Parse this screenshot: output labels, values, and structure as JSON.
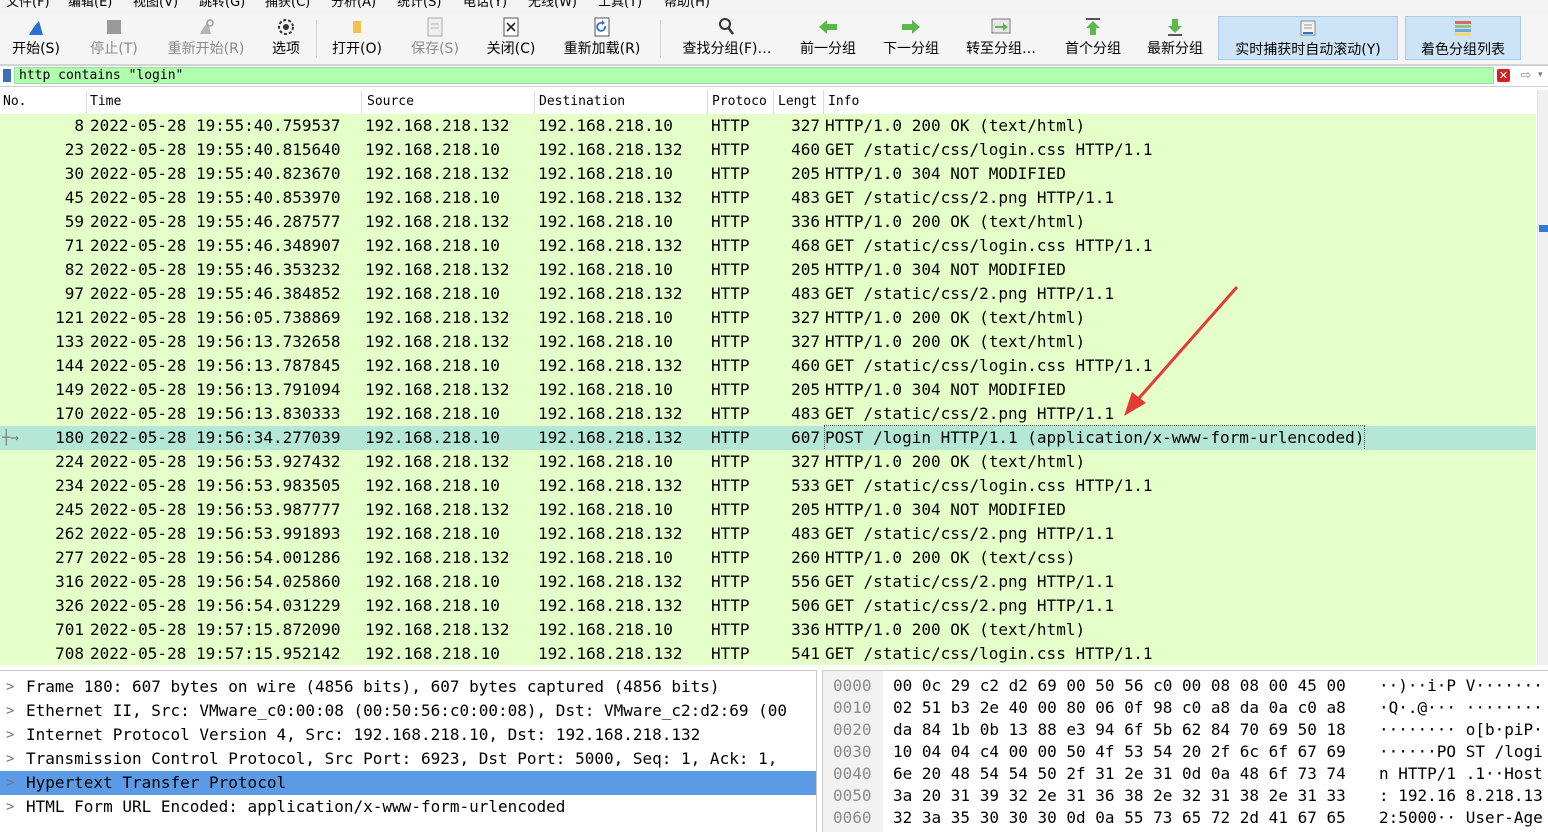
{
  "menu": [
    "文件(F)",
    "编辑(E)",
    "视图(V)",
    "跳转(G)",
    "捕获(C)",
    "分析(A)",
    "统计(S)",
    "电话(Y)",
    "无线(W)",
    "工具(T)",
    "帮助(H)"
  ],
  "toolbar": {
    "start": "开始(S)",
    "stop": "停止(T)",
    "restart": "重新开始(R)",
    "options": "选项",
    "open": "打开(O)",
    "save": "保存(S)",
    "close": "关闭(C)",
    "reload": "重新加载(R)",
    "find": "查找分组(F)…",
    "prev": "前一分组",
    "next": "下一分组",
    "goto": "转至分组…",
    "first": "首个分组",
    "last": "最新分组",
    "autoscroll": "实时捕获时自动滚动(Y)",
    "colorize": "着色分组列表"
  },
  "filter": {
    "value": "http contains \"login\"",
    "clear_glyph": "✕",
    "apply_glyph": "⇨"
  },
  "columns": [
    "No.",
    "Time",
    "Source",
    "Destination",
    "Protoco",
    "Lengt",
    "Info"
  ],
  "packets": [
    {
      "no": "8",
      "time": "2022-05-28 19:55:40.759537",
      "src": "192.168.218.132",
      "dst": "192.168.218.10",
      "proto": "HTTP",
      "len": "327",
      "info": "HTTP/1.0 200 OK  (text/html)"
    },
    {
      "no": "23",
      "time": "2022-05-28 19:55:40.815640",
      "src": "192.168.218.10",
      "dst": "192.168.218.132",
      "proto": "HTTP",
      "len": "460",
      "info": "GET /static/css/login.css HTTP/1.1"
    },
    {
      "no": "30",
      "time": "2022-05-28 19:55:40.823670",
      "src": "192.168.218.132",
      "dst": "192.168.218.10",
      "proto": "HTTP",
      "len": "205",
      "info": "HTTP/1.0 304 NOT MODIFIED"
    },
    {
      "no": "45",
      "time": "2022-05-28 19:55:40.853970",
      "src": "192.168.218.10",
      "dst": "192.168.218.132",
      "proto": "HTTP",
      "len": "483",
      "info": "GET /static/css/2.png HTTP/1.1"
    },
    {
      "no": "59",
      "time": "2022-05-28 19:55:46.287577",
      "src": "192.168.218.132",
      "dst": "192.168.218.10",
      "proto": "HTTP",
      "len": "336",
      "info": "HTTP/1.0 200 OK  (text/html)"
    },
    {
      "no": "71",
      "time": "2022-05-28 19:55:46.348907",
      "src": "192.168.218.10",
      "dst": "192.168.218.132",
      "proto": "HTTP",
      "len": "468",
      "info": "GET /static/css/login.css HTTP/1.1"
    },
    {
      "no": "82",
      "time": "2022-05-28 19:55:46.353232",
      "src": "192.168.218.132",
      "dst": "192.168.218.10",
      "proto": "HTTP",
      "len": "205",
      "info": "HTTP/1.0 304 NOT MODIFIED"
    },
    {
      "no": "97",
      "time": "2022-05-28 19:55:46.384852",
      "src": "192.168.218.10",
      "dst": "192.168.218.132",
      "proto": "HTTP",
      "len": "483",
      "info": "GET /static/css/2.png HTTP/1.1"
    },
    {
      "no": "121",
      "time": "2022-05-28 19:56:05.738869",
      "src": "192.168.218.132",
      "dst": "192.168.218.10",
      "proto": "HTTP",
      "len": "327",
      "info": "HTTP/1.0 200 OK  (text/html)"
    },
    {
      "no": "133",
      "time": "2022-05-28 19:56:13.732658",
      "src": "192.168.218.132",
      "dst": "192.168.218.10",
      "proto": "HTTP",
      "len": "327",
      "info": "HTTP/1.0 200 OK  (text/html)"
    },
    {
      "no": "144",
      "time": "2022-05-28 19:56:13.787845",
      "src": "192.168.218.10",
      "dst": "192.168.218.132",
      "proto": "HTTP",
      "len": "460",
      "info": "GET /static/css/login.css HTTP/1.1"
    },
    {
      "no": "149",
      "time": "2022-05-28 19:56:13.791094",
      "src": "192.168.218.132",
      "dst": "192.168.218.10",
      "proto": "HTTP",
      "len": "205",
      "info": "HTTP/1.0 304 NOT MODIFIED"
    },
    {
      "no": "170",
      "time": "2022-05-28 19:56:13.830333",
      "src": "192.168.218.10",
      "dst": "192.168.218.132",
      "proto": "HTTP",
      "len": "483",
      "info": "GET /static/css/2.png HTTP/1.1"
    },
    {
      "no": "180",
      "time": "2022-05-28 19:56:34.277039",
      "src": "192.168.218.10",
      "dst": "192.168.218.132",
      "proto": "HTTP",
      "len": "607",
      "info": "POST /login HTTP/1.1  (application/x-www-form-urlencoded)",
      "selected": true
    },
    {
      "no": "224",
      "time": "2022-05-28 19:56:53.927432",
      "src": "192.168.218.132",
      "dst": "192.168.218.10",
      "proto": "HTTP",
      "len": "327",
      "info": "HTTP/1.0 200 OK  (text/html)"
    },
    {
      "no": "234",
      "time": "2022-05-28 19:56:53.983505",
      "src": "192.168.218.10",
      "dst": "192.168.218.132",
      "proto": "HTTP",
      "len": "533",
      "info": "GET /static/css/login.css HTTP/1.1"
    },
    {
      "no": "245",
      "time": "2022-05-28 19:56:53.987777",
      "src": "192.168.218.132",
      "dst": "192.168.218.10",
      "proto": "HTTP",
      "len": "205",
      "info": "HTTP/1.0 304 NOT MODIFIED"
    },
    {
      "no": "262",
      "time": "2022-05-28 19:56:53.991893",
      "src": "192.168.218.10",
      "dst": "192.168.218.132",
      "proto": "HTTP",
      "len": "483",
      "info": "GET /static/css/2.png HTTP/1.1"
    },
    {
      "no": "277",
      "time": "2022-05-28 19:56:54.001286",
      "src": "192.168.218.132",
      "dst": "192.168.218.10",
      "proto": "HTTP",
      "len": "260",
      "info": "HTTP/1.0 200 OK  (text/css)"
    },
    {
      "no": "316",
      "time": "2022-05-28 19:56:54.025860",
      "src": "192.168.218.10",
      "dst": "192.168.218.132",
      "proto": "HTTP",
      "len": "556",
      "info": "GET /static/css/2.png HTTP/1.1"
    },
    {
      "no": "326",
      "time": "2022-05-28 19:56:54.031229",
      "src": "192.168.218.10",
      "dst": "192.168.218.132",
      "proto": "HTTP",
      "len": "506",
      "info": "GET /static/css/2.png HTTP/1.1"
    },
    {
      "no": "701",
      "time": "2022-05-28 19:57:15.872090",
      "src": "192.168.218.132",
      "dst": "192.168.218.10",
      "proto": "HTTP",
      "len": "336",
      "info": "HTTP/1.0 200 OK  (text/html)"
    },
    {
      "no": "708",
      "time": "2022-05-28 19:57:15.952142",
      "src": "192.168.218.10",
      "dst": "192.168.218.132",
      "proto": "HTTP",
      "len": "541",
      "info": "GET /static/css/login.css HTTP/1.1"
    }
  ],
  "details": [
    "Frame 180: 607 bytes on wire (4856 bits), 607 bytes captured (4856 bits)",
    "Ethernet II, Src: VMware_c0:00:08 (00:50:56:c0:00:08), Dst: VMware_c2:d2:69 (00",
    "Internet Protocol Version 4, Src: 192.168.218.10, Dst: 192.168.218.132",
    "Transmission Control Protocol, Src Port: 6923, Dst Port: 5000, Seq: 1, Ack: 1,",
    "Hypertext Transfer Protocol",
    "HTML Form URL Encoded: application/x-www-form-urlencoded"
  ],
  "details_selected": 4,
  "bytes": [
    {
      "off": "0000",
      "hex": "00 0c 29 c2 d2 69 00 50  56 c0 00 08 08 00 45 00",
      "ascii": "··)··i·P V·······"
    },
    {
      "off": "0010",
      "hex": "02 51 b3 2e 40 00 80 06  0f 98 c0 a8 da 0a c0 a8",
      "ascii": "·Q·.@··· ········"
    },
    {
      "off": "0020",
      "hex": "da 84 1b 0b 13 88 e3 94  6f 5b 62 84 70 69 50 18",
      "ascii": "········ o[b·piP·"
    },
    {
      "off": "0030",
      "hex": "10 04 04 c4 00 00 50 4f  53 54 20 2f 6c 6f 67 69",
      "ascii": "······PO ST /logi"
    },
    {
      "off": "0040",
      "hex": "6e 20 48 54 54 50 2f 31  2e 31 0d 0a 48 6f 73 74",
      "ascii": "n HTTP/1 .1··Host"
    },
    {
      "off": "0050",
      "hex": "3a 20 31 39 32 2e 31 36  38 2e 32 31 38 2e 31 33",
      "ascii": ": 192.16 8.218.13"
    },
    {
      "off": "0060",
      "hex": "32 3a 35 30 30 30 0d 0a  55 73 65 72 2d 41 67 65",
      "ascii": "2:5000·· User-Age"
    }
  ],
  "colors": {
    "row_bg": "#e4ffc7",
    "row_selected_bg": "#b4e7d6",
    "filter_bg": "#afffaf",
    "detail_selected_bg": "#5b9be6",
    "annotation_arrow": "#e53935"
  }
}
